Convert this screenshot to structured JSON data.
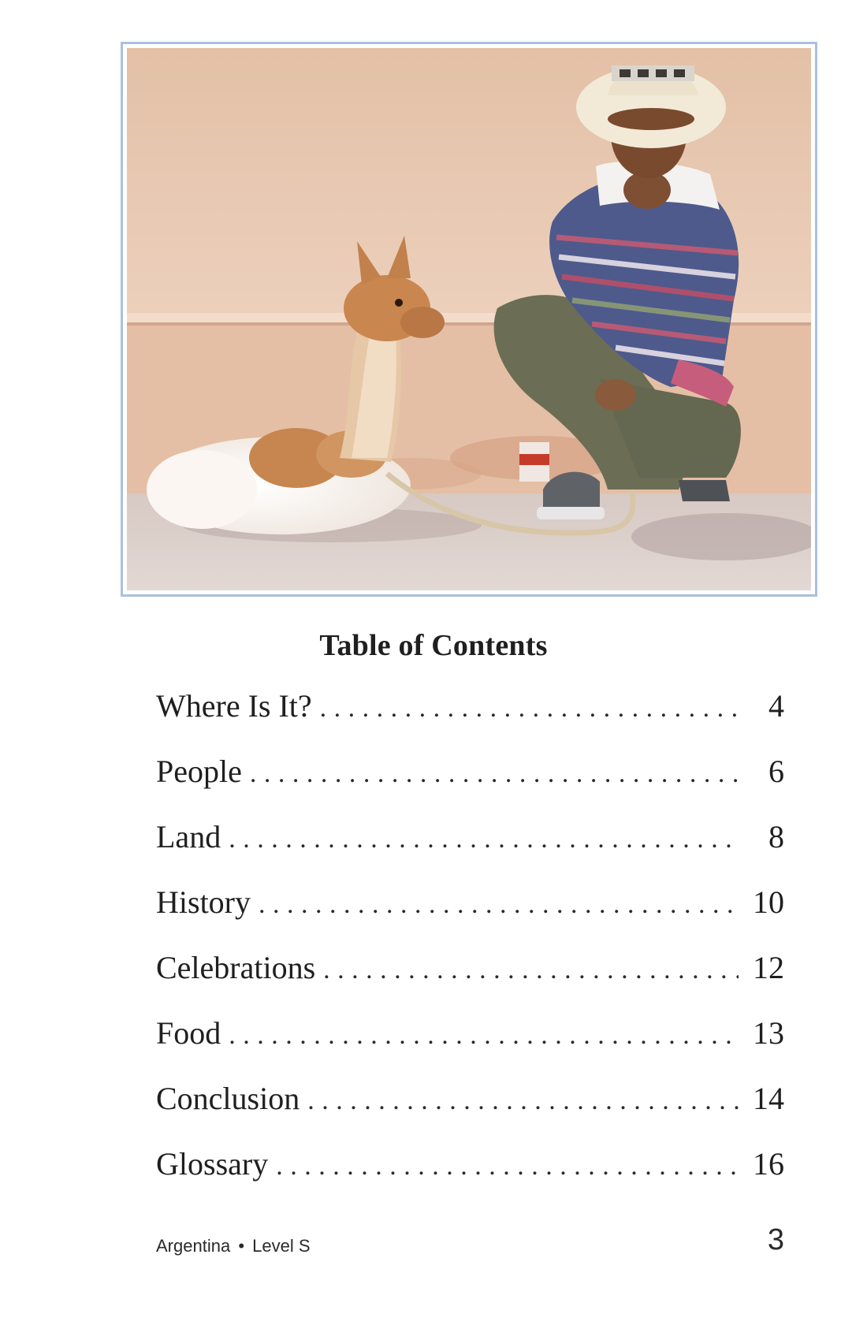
{
  "toc": {
    "title": "Table of Contents",
    "entries": [
      {
        "label": "Where Is It?",
        "page": "4"
      },
      {
        "label": "People",
        "page": "6"
      },
      {
        "label": "Land",
        "page": "8"
      },
      {
        "label": "History",
        "page": "10"
      },
      {
        "label": "Celebrations",
        "page": "12"
      },
      {
        "label": "Food",
        "page": "13"
      },
      {
        "label": "Conclusion",
        "page": "14"
      },
      {
        "label": "Glossary",
        "page": "16"
      }
    ]
  },
  "footer": {
    "book_title": "Argentina",
    "separator": "•",
    "level": "Level S",
    "page_number": "3"
  },
  "colors": {
    "photo_border": "#a9c1de",
    "wall": "#e9c9b2",
    "text": "#1f1f1f"
  }
}
